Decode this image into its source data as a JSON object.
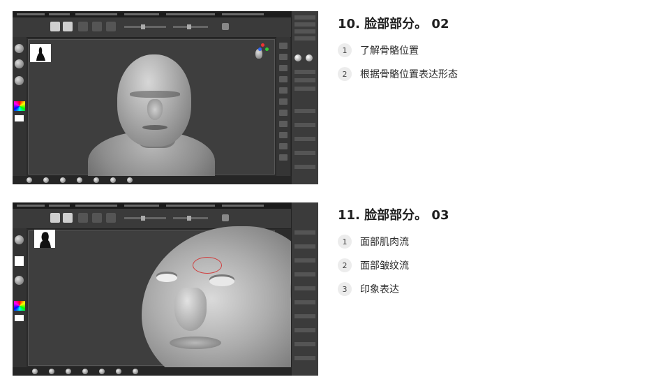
{
  "lessons": [
    {
      "title": "10. 脸部部分。 02",
      "thumbnail_icon": "zbrush-sculpt-screenshot",
      "items": [
        {
          "num": "1",
          "text": "了解骨骼位置"
        },
        {
          "num": "2",
          "text": "根据骨骼位置表达形态"
        }
      ]
    },
    {
      "title": "11. 脸部部分。 03",
      "thumbnail_icon": "zbrush-sculpt-screenshot",
      "items": [
        {
          "num": "1",
          "text": "面部肌肉流"
        },
        {
          "num": "2",
          "text": "面部皱纹流"
        },
        {
          "num": "3",
          "text": "印象表达"
        }
      ]
    }
  ],
  "colors": {
    "background": "#ffffff",
    "badge": "#ececec",
    "title": "#1f1f1f"
  }
}
